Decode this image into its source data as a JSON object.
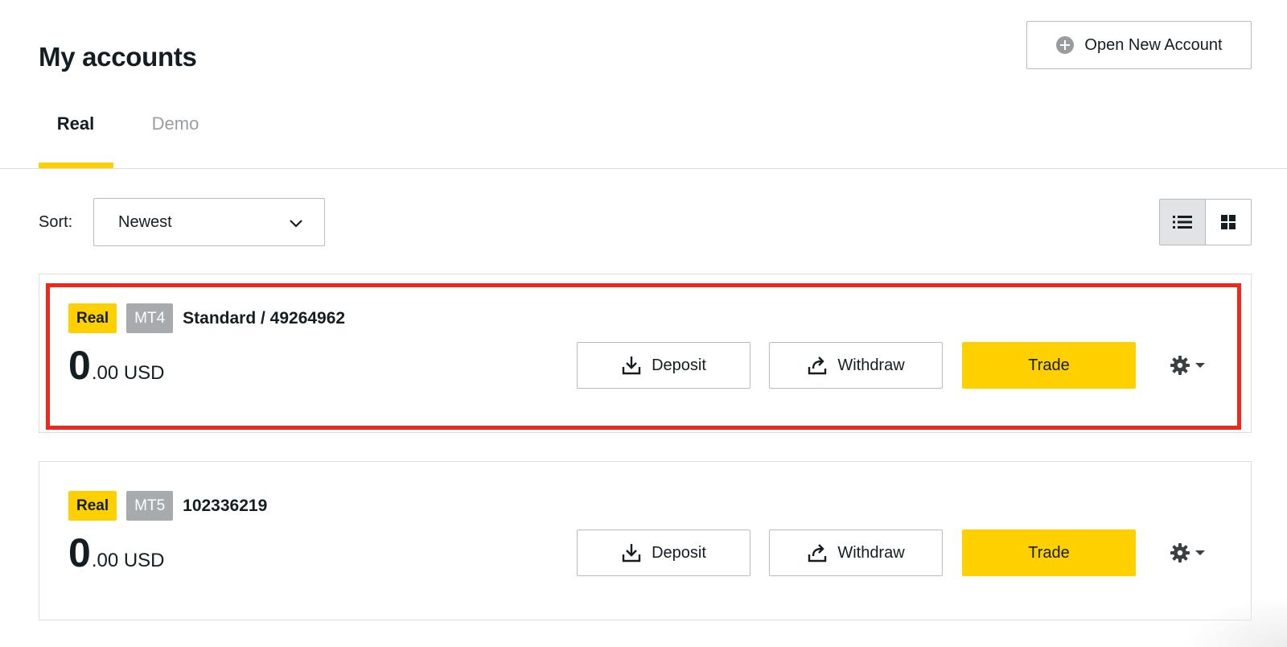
{
  "page": {
    "title": "My accounts",
    "open_account_label": "Open New Account"
  },
  "tabs": [
    {
      "label": "Real",
      "active": true
    },
    {
      "label": "Demo",
      "active": false
    }
  ],
  "sort": {
    "label": "Sort:",
    "selected": "Newest"
  },
  "view_modes": [
    "list",
    "grid"
  ],
  "accounts": [
    {
      "type_badge": "Real",
      "platform_badge": "MT4",
      "name": "Standard / 49264962",
      "balance_int": "0",
      "balance_rest": ".00 USD",
      "highlighted": true
    },
    {
      "type_badge": "Real",
      "platform_badge": "MT5",
      "name": "102336219",
      "balance_int": "0",
      "balance_rest": ".00 USD",
      "highlighted": false
    }
  ],
  "actions": {
    "deposit_label": "Deposit",
    "withdraw_label": "Withdraw",
    "trade_label": "Trade"
  },
  "colors": {
    "accent": "#ffd000",
    "highlight_border": "#f2261b",
    "badge_gray": "#a8abad"
  },
  "icons": {
    "open_account": "plus-circle-icon",
    "sort": "chevron-down-icon",
    "list_view": "list-icon",
    "grid_view": "grid-icon",
    "deposit": "download-icon",
    "withdraw": "share-out-icon",
    "settings": "gear-icon"
  }
}
